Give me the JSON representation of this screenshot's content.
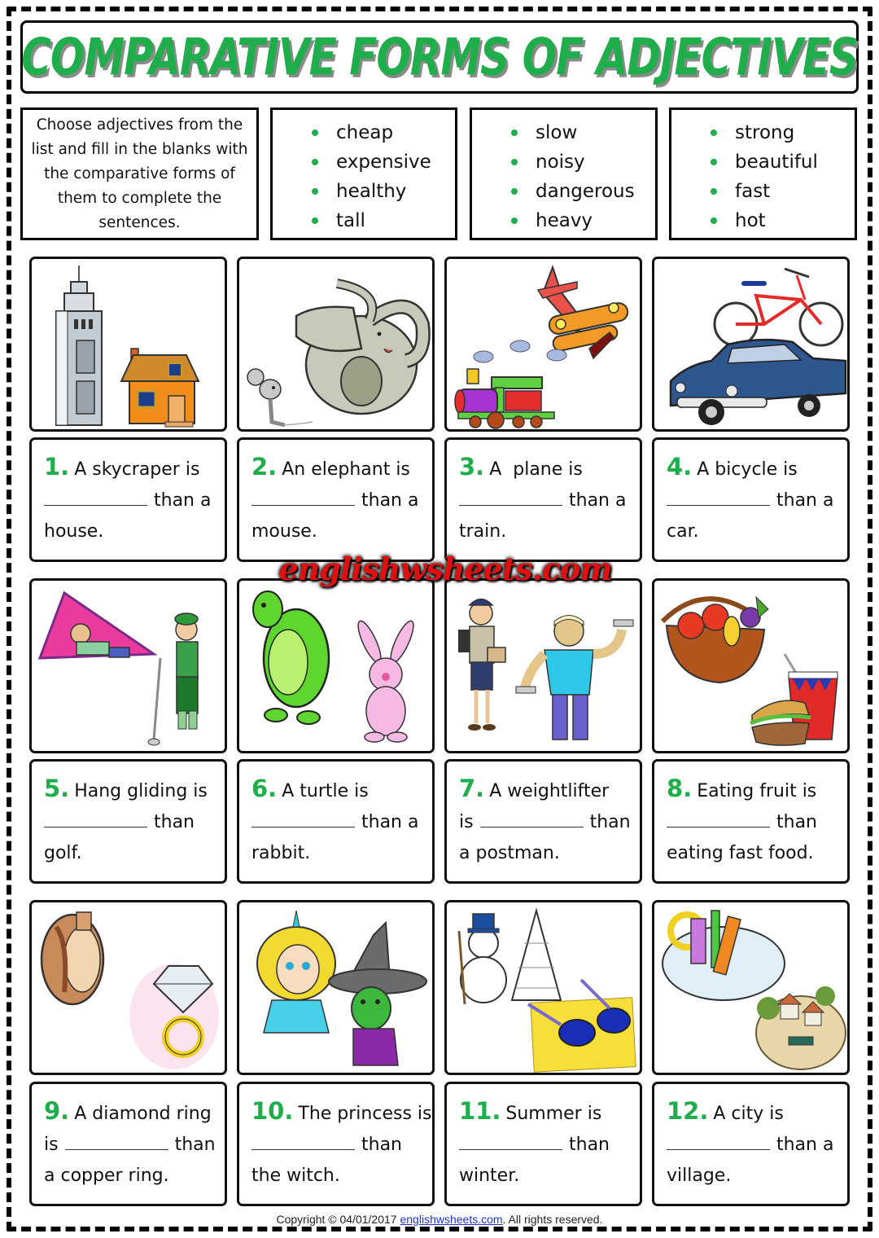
{
  "title": "COMPARATIVE FORMS OF ADJECTIVES",
  "instructions": "Choose adjectives from the list and fill in the blanks with the comparative forms of them to complete the sentences.",
  "word_lists": [
    [
      "cheap",
      "expensive",
      "healthy",
      "tall"
    ],
    [
      "slow",
      "noisy",
      "dangerous",
      "heavy"
    ],
    [
      "strong",
      "beautiful",
      "fast",
      "hot"
    ]
  ],
  "accent_color": "#1fae4b",
  "watermark": "englishwsheets.com",
  "exercises": [
    {
      "number": "1.",
      "line1": "A skycraper is",
      "line2_pre": "",
      "line2_post": "than a",
      "line3": "house.",
      "image": "skyscraper and house"
    },
    {
      "number": "2.",
      "line1": "An elephant is",
      "line2_pre": "",
      "line2_post": "than a",
      "line3": "mouse.",
      "image": "elephant and mouse"
    },
    {
      "number": "3.",
      "line1": "A  plane is",
      "line2_pre": "",
      "line2_post": "than a",
      "line3": "train.",
      "image": "plane and train"
    },
    {
      "number": "4.",
      "line1": "A bicycle is",
      "line2_pre": "",
      "line2_post": "than a",
      "line3": "car.",
      "image": "bicycle and car"
    },
    {
      "number": "5.",
      "line1": "Hang gliding is",
      "line2_pre": "",
      "line2_post": "than",
      "line3": "golf.",
      "image": "hang glider and golfer"
    },
    {
      "number": "6.",
      "line1": "A turtle is",
      "line2_pre": "",
      "line2_post": "than a",
      "line3": "rabbit.",
      "image": "turtle and rabbit"
    },
    {
      "number": "7.",
      "line1": "A weightlifter",
      "line2_pre": "is",
      "line2_post": "than",
      "line3": "a postman.",
      "image": "postman and weightlifter"
    },
    {
      "number": "8.",
      "line1": "Eating fruit is",
      "line2_pre": "",
      "line2_post": "than",
      "line3": "eating fast food.",
      "image": "fruit basket and fast food"
    },
    {
      "number": "9.",
      "line1": "A diamond ring",
      "line2_pre": "is",
      "line2_post": "than",
      "line3": "a copper ring.",
      "image": "copper ring and diamond ring"
    },
    {
      "number": "10.",
      "line1": "The princess is",
      "line2_pre": "",
      "line2_post": "than",
      "line3": "the witch.",
      "image": "princess and witch"
    },
    {
      "number": "11.",
      "line1": "Summer is",
      "line2_pre": "",
      "line2_post": "than",
      "line3": "winter.",
      "image": "snowman and sunglasses"
    },
    {
      "number": "12.",
      "line1": "A city is",
      "line2_pre": "",
      "line2_post": "than a",
      "line3": "village.",
      "image": "city and village"
    }
  ],
  "footer": {
    "prefix": "Copyright © 04/01/2017 ",
    "link": "englishwsheets.com",
    "suffix": ". All rights reserved."
  }
}
